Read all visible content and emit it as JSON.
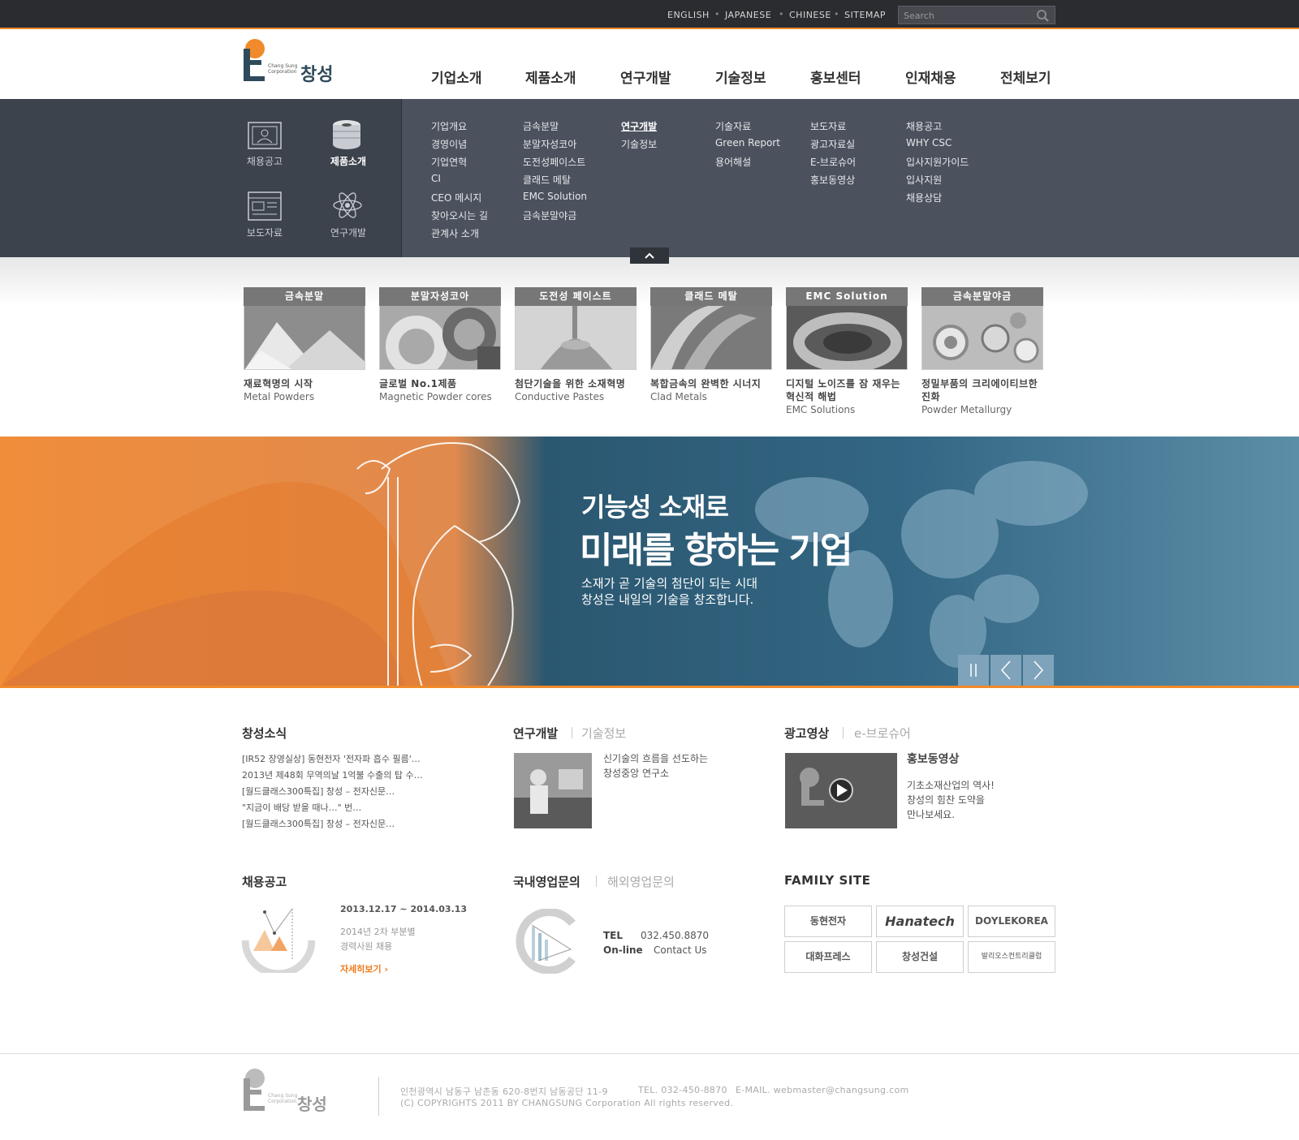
{
  "topbar": {
    "links": [
      "ENGLISH",
      "JAPANESE",
      "CHINESE",
      "SITEMAP"
    ],
    "search_placeholder": "Search"
  },
  "logo": {
    "en": "Chang Sung Corporation",
    "ko": "창성",
    "accent": "#f08a2a"
  },
  "nav": [
    "기업소개",
    "제품소개",
    "연구개발",
    "기술정보",
    "홍보센터",
    "인재채용",
    "전체보기"
  ],
  "quick_links": [
    "채용공고",
    "제품소개",
    "보도자료",
    "연구개발"
  ],
  "submenu": {
    "company": [
      "기업개요",
      "경영이념",
      "기업연혁",
      "CI",
      "CEO 메시지",
      "찾아오시는 길",
      "관계사 소개"
    ],
    "products": [
      "금속분말",
      "분말자성코아",
      "도전성페이스트",
      "클래드 메탈",
      "EMC Solution",
      "금속분말야금"
    ],
    "research": [
      "연구개발",
      "기술정보"
    ],
    "tech": [
      "기술자료",
      "Green Report",
      "용어해설"
    ],
    "pr": [
      "보도자료",
      "광고자료실",
      "E-브로슈어",
      "홍보동영상"
    ],
    "recruit": [
      "채용공고",
      "WHY CSC",
      "입사지원가이드",
      "입사지원",
      "채용상담"
    ]
  },
  "products": [
    {
      "head": "금속분말",
      "title": "재료혁명의 시작",
      "sub": "Metal Powders"
    },
    {
      "head": "분말자성코아",
      "title": "글로벌 No.1제품",
      "sub": "Magnetic Powder cores"
    },
    {
      "head": "도전성 페이스트",
      "title": "첨단기술을 위한 소재혁명",
      "sub": "Conductive Pastes"
    },
    {
      "head": "클래드 메탈",
      "title": "복합금속의 완벽한 시너지",
      "sub": "Clad Metals"
    },
    {
      "head": "EMC Solution",
      "title": "디지털 노이즈를 잠 재우는 혁신적 해법",
      "sub": "EMC Solutions"
    },
    {
      "head": "금속분말야금",
      "title": "정밀부품의 크리에이티브한 진화",
      "sub": "Powder Metallurgy"
    }
  ],
  "banner": {
    "line1": "기능성 소재로",
    "line2": "미래를 향하는 기업",
    "desc1": "소재가 곧 기술의 첨단이 되는 시대",
    "desc2": "창성은 내일의 기술을 창조합니다."
  },
  "news": {
    "title": "창성소식",
    "items": [
      "[IR52 장영실상] 동현전자 '전자파 흡수 필름'…",
      "2013년 제48회 무역의날 1억불 수출의 탑 수…",
      "[월드클래스300특집] 창성 – 전자신문…",
      "\"지금이 배당 받을 때나…\" 번…",
      "[월드클래스300특집] 창성 – 전자신문…"
    ]
  },
  "rnd": {
    "title": "연구개발",
    "tab": "기술정보",
    "desc1": "신기술의 흐름을 선도하는",
    "desc2": "창성중앙 연구소"
  },
  "media": {
    "title": "광고영상",
    "tab": "e-브로슈어",
    "heading": "홍보동영상",
    "desc1": "기초소재산업의 역사!",
    "desc2": "창성의 힘찬 도약을",
    "desc3": "만나보세요."
  },
  "recruit": {
    "title": "채용공고",
    "date": "2013.12.17 ~ 2014.03.13",
    "desc1": "2014년 2차 부분별",
    "desc2": "경력사원 채용",
    "more": "자세히보기"
  },
  "inquiry": {
    "title": "국내영업문의",
    "tab": "해외영업문의",
    "tel_label": "TEL",
    "tel": "032.450.8870",
    "online_label": "On-line",
    "online": "Contact Us"
  },
  "family": {
    "title": "FAMILY SITE",
    "sites": [
      "동현전자",
      "Hanatech",
      "DOYLEKOREA",
      "대화프레스",
      "창성건설",
      "발리오스컨트리클럽"
    ]
  },
  "footer": {
    "address": "인천광역시 남동구 남촌동 620-8번지 남동공단 11-9",
    "tel": "TEL. 032-450-8870",
    "email": "E-MAIL. webmaster@changsung.com",
    "copyright": "(C) COPYRIGHTS 2011 BY CHANGSUNG Corporation All rights reserved."
  }
}
